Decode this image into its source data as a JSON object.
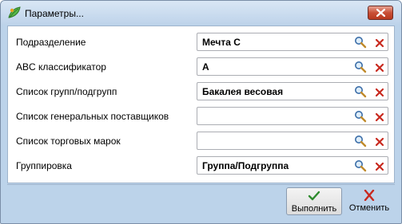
{
  "window": {
    "title": "Параметры..."
  },
  "params": [
    {
      "label": "Подразделение",
      "value": "Мечта С"
    },
    {
      "label": "ABC классификатор",
      "value": "A"
    },
    {
      "label": "Список групп/подгрупп",
      "value": "Бакалея весовая"
    },
    {
      "label": "Список генеральных поставщиков",
      "value": ""
    },
    {
      "label": "Список торговых марок",
      "value": ""
    },
    {
      "label": "Группировка",
      "value": "Группа/Подгруппа"
    }
  ],
  "buttons": {
    "run_label": "Выполнить",
    "cancel_label": "Отменить"
  },
  "icons": {
    "app": "app-leaf-icon",
    "close": "close-icon",
    "search": "magnifier-icon",
    "clear": "red-x-icon",
    "run": "green-check-icon",
    "cancel": "red-x-icon"
  },
  "colors": {
    "clear_red": "#c8281e",
    "check_green": "#2e8b2e",
    "title_bar": "#bed3ea"
  }
}
